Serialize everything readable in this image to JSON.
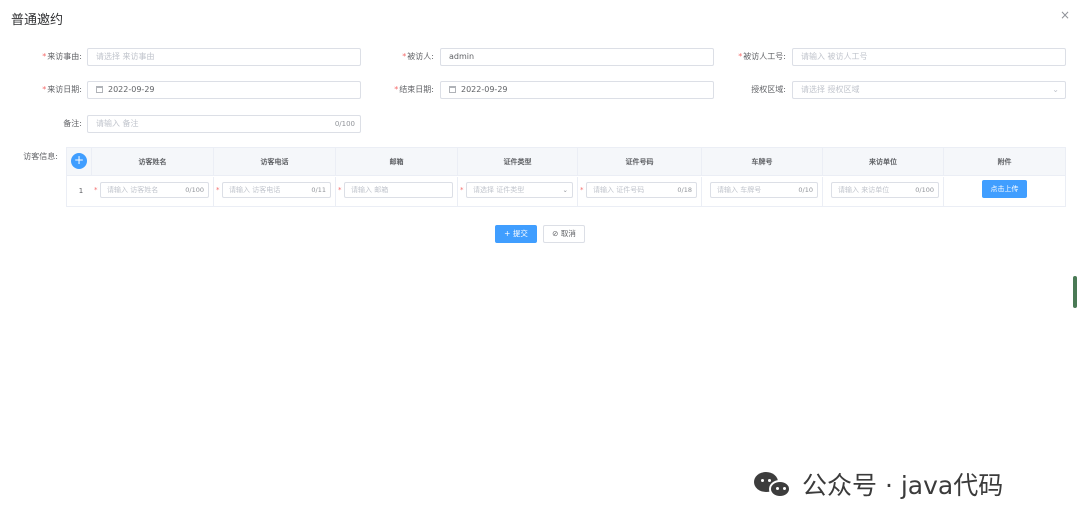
{
  "dialog": {
    "title": "普通邀约",
    "close_icon": "×"
  },
  "form": {
    "visit_reason": {
      "label": "来访事由:",
      "placeholder": "请选择 来访事由"
    },
    "visitee": {
      "label": "被访人:",
      "value": "admin"
    },
    "visitee_id": {
      "label": "被访人工号:",
      "placeholder": "请输入 被访人工号"
    },
    "visit_date": {
      "label": "来访日期:",
      "value": "2022-09-29"
    },
    "end_date": {
      "label": "结束日期:",
      "value": "2022-09-29"
    },
    "auth_area": {
      "label": "授权区域:",
      "placeholder": "请选择 授权区域"
    },
    "remark": {
      "label": "备注:",
      "placeholder": "请输入 备注",
      "count": "0/100"
    }
  },
  "visitors": {
    "label": "访客信息:",
    "add_icon": "+",
    "columns": [
      "访客姓名",
      "访客电话",
      "邮箱",
      "证件类型",
      "证件号码",
      "车牌号",
      "来访单位",
      "附件"
    ],
    "row": {
      "index": "1",
      "name": {
        "placeholder": "请输入 访客姓名",
        "count": "0/100"
      },
      "phone": {
        "placeholder": "请输入 访客电话",
        "count": "0/11"
      },
      "email": {
        "placeholder": "请输入 邮箱"
      },
      "id_type": {
        "placeholder": "请选择 证件类型"
      },
      "id_number": {
        "placeholder": "请输入 证件号码",
        "count": "0/18"
      },
      "plate": {
        "placeholder": "请输入 车牌号",
        "count": "0/10"
      },
      "company": {
        "placeholder": "请输入 来访单位",
        "count": "0/100"
      },
      "upload_label": "点击上传"
    }
  },
  "actions": {
    "submit_label": "+ 提交",
    "cancel_label": "⊘ 取消"
  },
  "watermark": {
    "text": "公众号 · java代码"
  },
  "colors": {
    "primary": "#409eff",
    "required": "#f56c6c",
    "border": "#dcdfe6"
  }
}
